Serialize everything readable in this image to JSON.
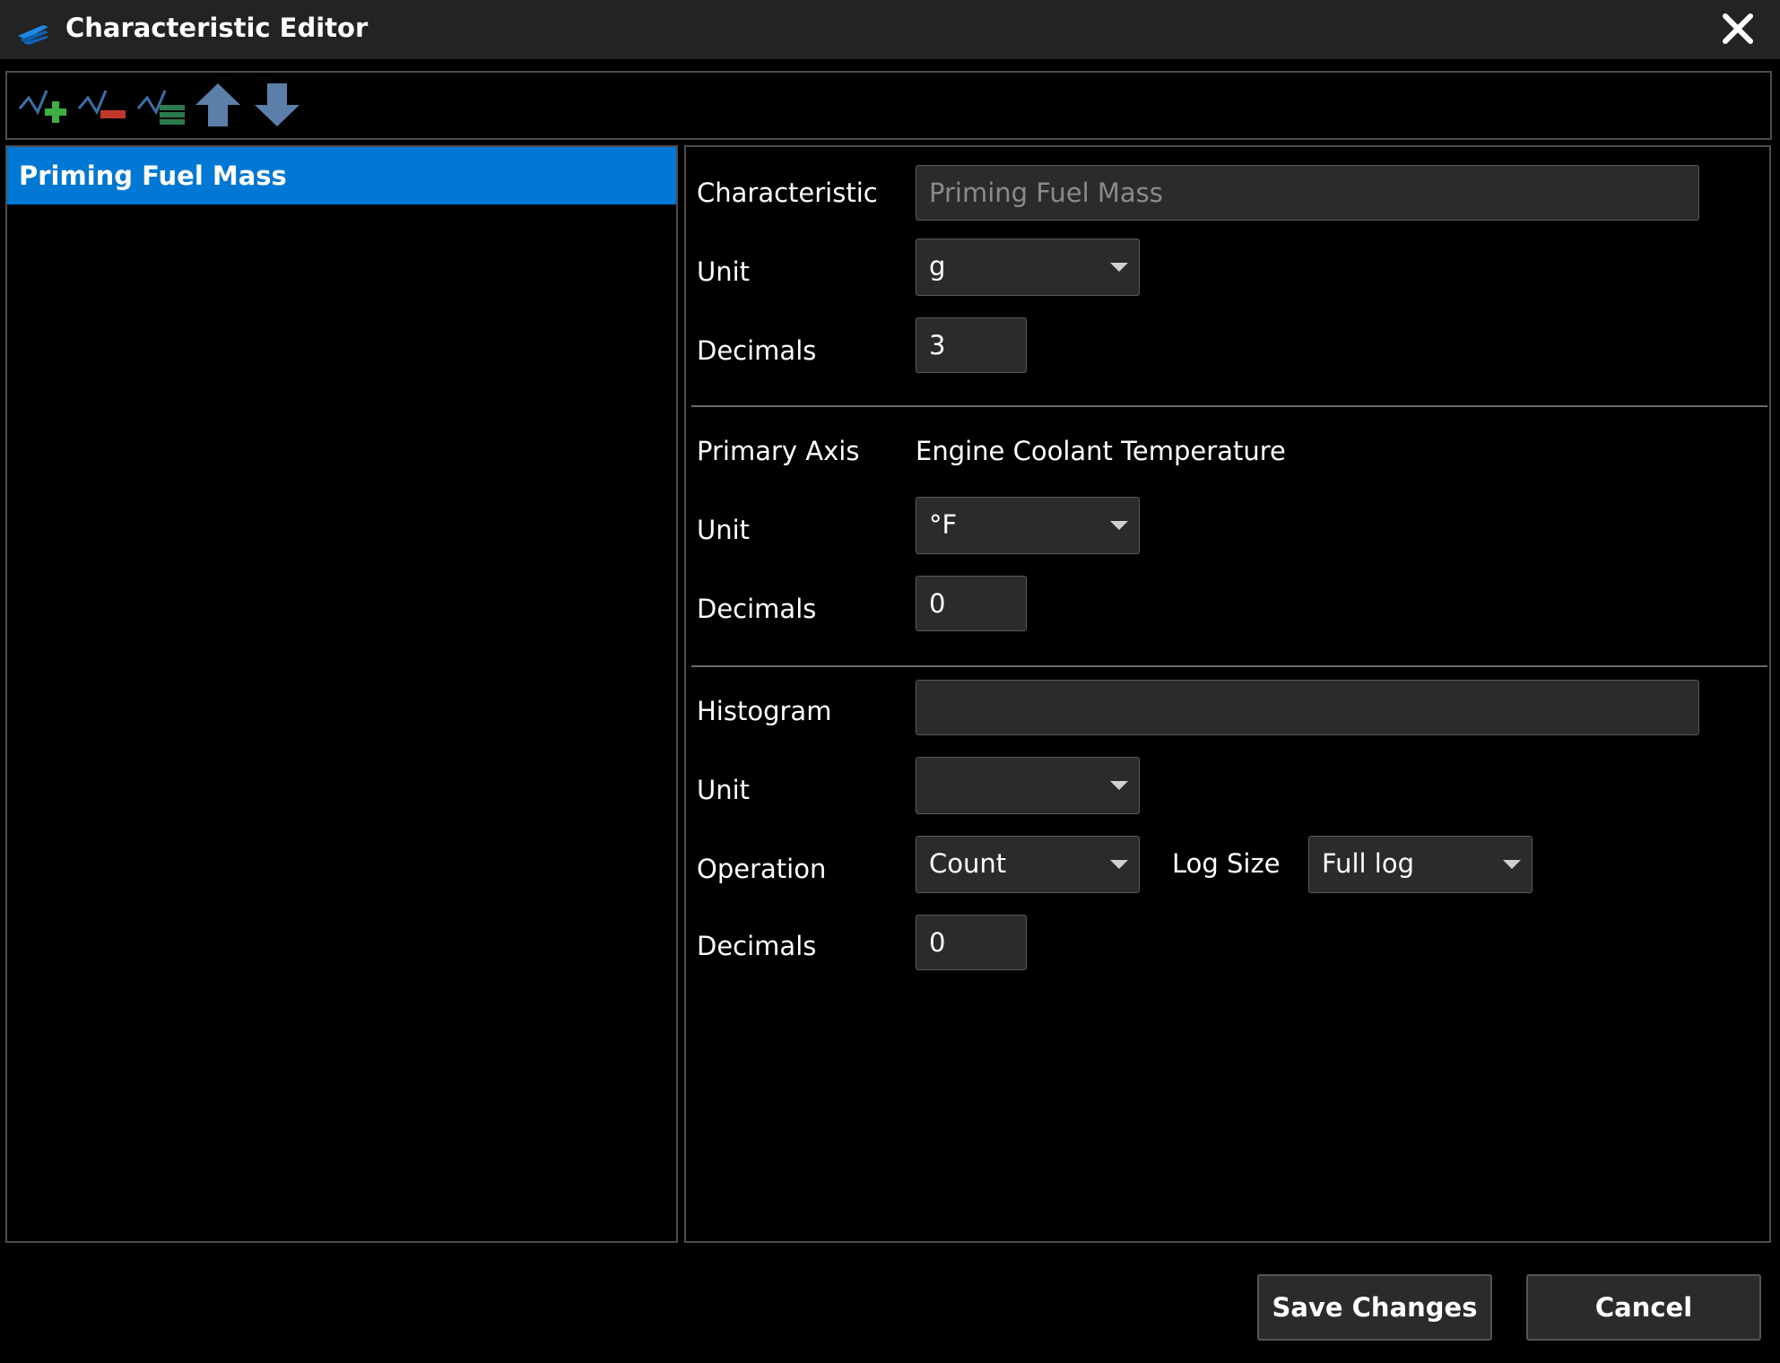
{
  "window": {
    "title": "Characteristic Editor"
  },
  "toolbar": {
    "buttons": [
      {
        "icon": "add-characteristic-icon"
      },
      {
        "icon": "remove-characteristic-icon"
      },
      {
        "icon": "edit-characteristic-icon"
      },
      {
        "icon": "move-up-icon"
      },
      {
        "icon": "move-down-icon"
      }
    ]
  },
  "list": {
    "items": [
      "Priming Fuel Mass"
    ],
    "selected_color": "#0078d4"
  },
  "form": {
    "characteristic": {
      "label": "Characteristic",
      "value": "Priming Fuel Mass",
      "unit_label": "Unit",
      "unit_value": "g",
      "decimals_label": "Decimals",
      "decimals_value": "3"
    },
    "primary_axis": {
      "label": "Primary Axis",
      "value": "Engine Coolant Temperature",
      "unit_label": "Unit",
      "unit_value": "°F",
      "decimals_label": "Decimals",
      "decimals_value": "0"
    },
    "histogram": {
      "label": "Histogram",
      "value": "",
      "unit_label": "Unit",
      "unit_value": "",
      "operation_label": "Operation",
      "operation_value": "Count",
      "log_size_label": "Log Size",
      "log_size_value": "Full log",
      "decimals_label": "Decimals",
      "decimals_value": "0"
    }
  },
  "footer": {
    "save_label": "Save Changes",
    "cancel_label": "Cancel"
  }
}
